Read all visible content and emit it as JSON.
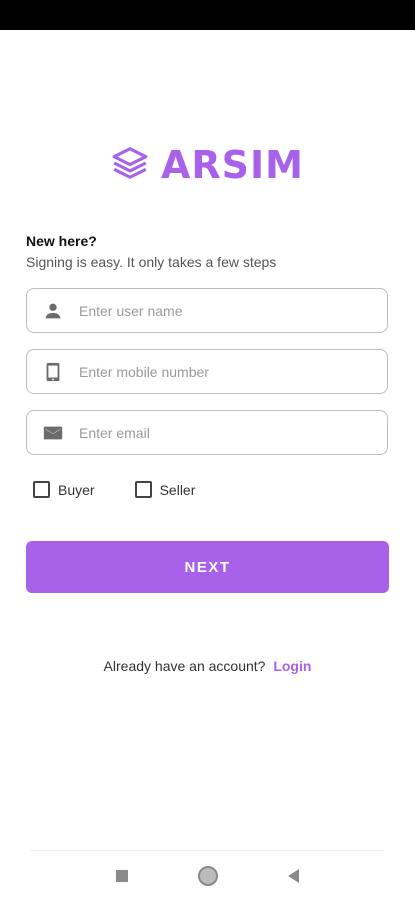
{
  "app": {
    "name": "ARSIM",
    "brand_color": "#a862ea"
  },
  "header": {
    "title": "New here?",
    "subtitle": "Signing is easy. It only takes a few steps"
  },
  "form": {
    "username": {
      "placeholder": "Enter user name",
      "icon": "person-icon"
    },
    "mobile": {
      "placeholder": "Enter mobile number",
      "icon": "phone-icon"
    },
    "email": {
      "placeholder": "Enter email",
      "icon": "mail-icon"
    },
    "roles": [
      {
        "label": "Buyer",
        "checked": false
      },
      {
        "label": "Seller",
        "checked": false
      }
    ],
    "next_label": "NEXT"
  },
  "footer": {
    "prompt": "Already have an account?",
    "login_label": "Login"
  }
}
